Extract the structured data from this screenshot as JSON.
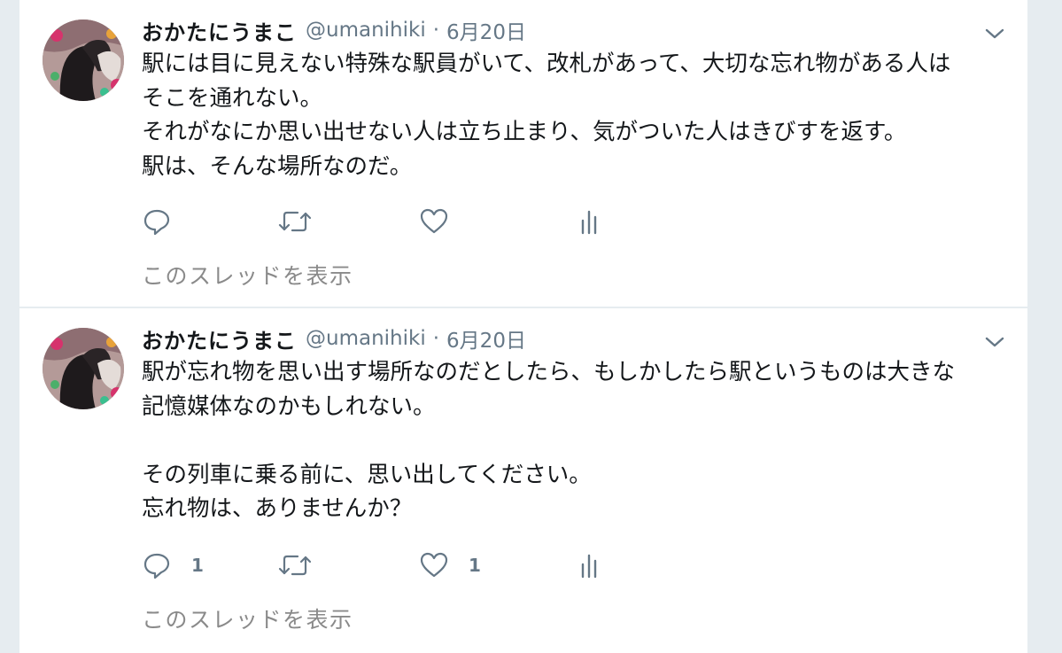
{
  "tweets": [
    {
      "author_name": "おかたにうまこ",
      "handle": "@umanihiki",
      "separator": "·",
      "date": "6月20日",
      "text": "駅には目に見えない特殊な駅員がいて、改札があって、大切な忘れ物がある人は\nそこを通れない。\nそれがなにか思い出せない人は立ち止まり、気がついた人はきびすを返す。\n駅は、そんな場所なのだ。",
      "reply_count": "",
      "like_count": "",
      "show_thread": "このスレッドを表示",
      "icons": [
        "avatar",
        "chevron-down-icon",
        "reply-icon",
        "retweet-icon",
        "heart-icon",
        "analytics-icon"
      ]
    },
    {
      "author_name": "おかたにうまこ",
      "handle": "@umanihiki",
      "separator": "·",
      "date": "6月20日",
      "text": "駅が忘れ物を思い出す場所なのだとしたら、もしかしたら駅というものは大きな\n記憶媒体なのかもしれない。\n\nその列車に乗る前に、思い出してください。\n忘れ物は、ありませんか？",
      "reply_count": "1",
      "like_count": "1",
      "show_thread": "このスレッドを表示",
      "icons": [
        "avatar",
        "chevron-down-icon",
        "reply-icon",
        "retweet-icon",
        "heart-icon",
        "analytics-icon"
      ]
    }
  ],
  "colors": {
    "background": "#e6ecf0",
    "card": "#ffffff",
    "text": "#14171a",
    "secondary": "#657786",
    "thread_link": "#8a8a8a"
  }
}
